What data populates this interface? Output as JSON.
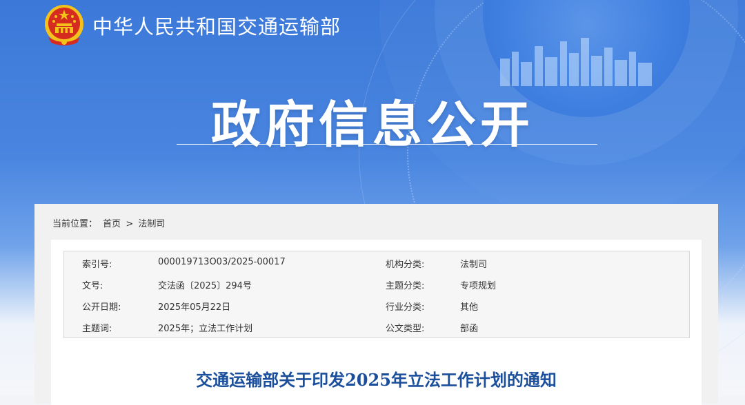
{
  "header": {
    "site_name": "中华人民共和国交通运输部",
    "page_title": "政府信息公开"
  },
  "breadcrumb": {
    "prefix": "当前位置：",
    "items": [
      "首页",
      "法制司"
    ],
    "separator": ">"
  },
  "meta": [
    {
      "k1": "索引号:",
      "v1": "000019713O03/2025-00017",
      "k2": "机构分类:",
      "v2": "法制司"
    },
    {
      "k1": "文号:",
      "v1": "交法函〔2025〕294号",
      "k2": "主题分类:",
      "v2": "专项规划"
    },
    {
      "k1": "公开日期:",
      "v1": "2025年05月22日",
      "k2": "行业分类:",
      "v2": "其他"
    },
    {
      "k1": "主题词:",
      "v1": "2025年；立法工作计划",
      "k2": "公文类型:",
      "v2": "部函"
    }
  ],
  "document": {
    "title": "交通运输部关于印发2025年立法工作计划的通知"
  },
  "colors": {
    "hero_blue": "#3b78d8",
    "title_blue": "#1b4f9c",
    "emblem_red": "#d62b1f",
    "emblem_gold": "#f3c21b"
  }
}
